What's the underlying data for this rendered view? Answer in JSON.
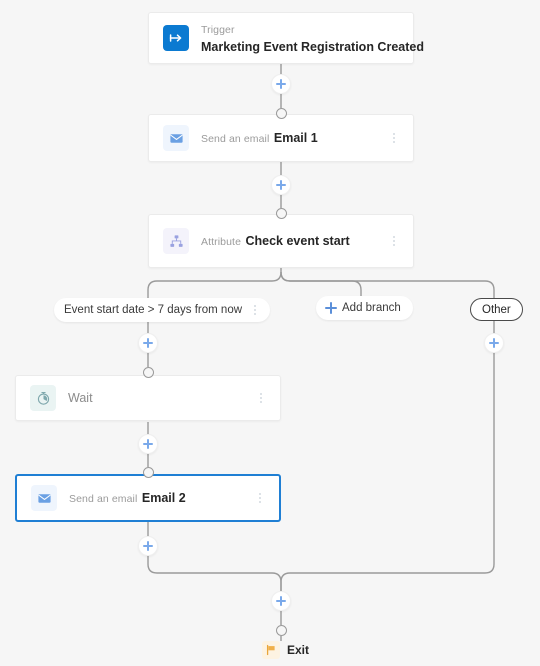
{
  "canvas": {
    "background_color": "#f6f6f6",
    "accent_color": "#1f7fd4",
    "plus_color": "#7aa9ea"
  },
  "nodes": [
    {
      "id": "trigger",
      "icon": "trigger-arrow-icon",
      "subtitle": "Trigger",
      "title": "Marketing Event Registration Created",
      "has_kebab": false,
      "selected": false
    },
    {
      "id": "email-1",
      "icon": "envelope-icon",
      "subtitle": "Send an email",
      "title": "Email 1",
      "has_kebab": true,
      "selected": false
    },
    {
      "id": "attribute",
      "icon": "hierarchy-icon",
      "subtitle": "Attribute",
      "title": "Check event start",
      "has_kebab": true,
      "selected": false
    },
    {
      "id": "wait",
      "icon": "timer-icon",
      "subtitle": "",
      "title": "Wait",
      "has_kebab": true,
      "selected": false
    },
    {
      "id": "email-2",
      "icon": "envelope-icon",
      "subtitle": "Send an email",
      "title": "Email 2",
      "has_kebab": true,
      "selected": true
    }
  ],
  "branches": {
    "condition_label": "Event start date > 7 days from now",
    "add_branch_label": "Add branch",
    "other_label": "Other"
  },
  "exit": {
    "label": "Exit",
    "icon": "flag-icon"
  },
  "controls": {
    "add_step_label": "+",
    "kebab_label": "More options"
  }
}
